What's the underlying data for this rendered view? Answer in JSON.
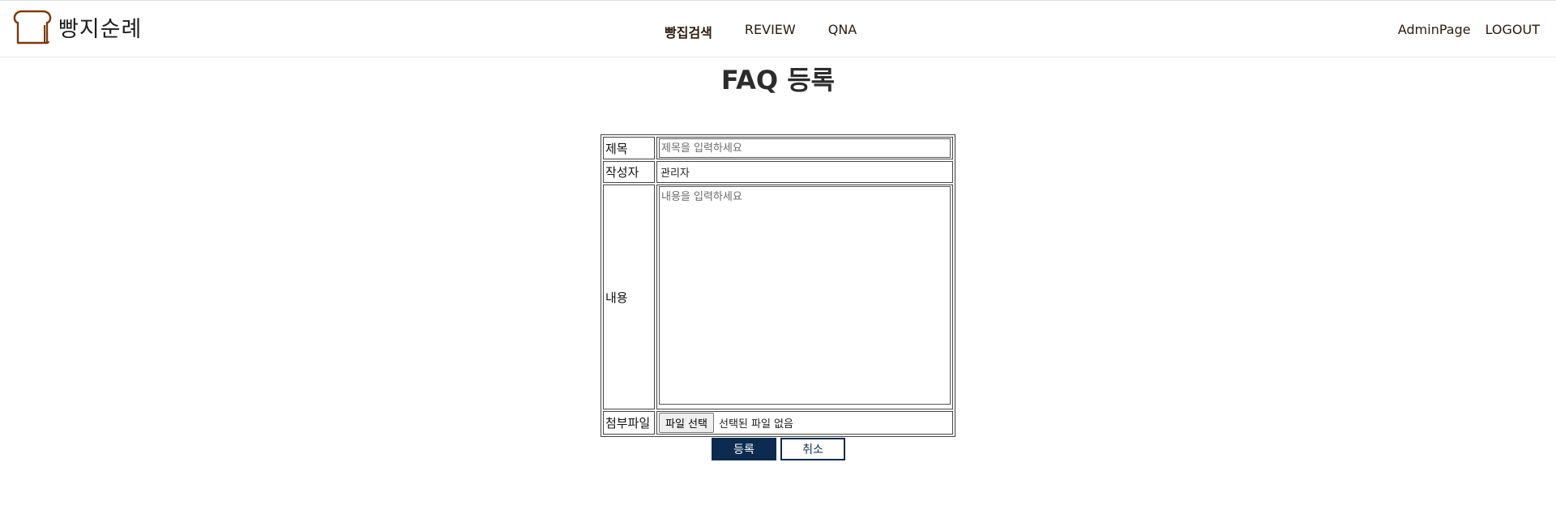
{
  "header": {
    "logo_text": "빵지순례",
    "nav": [
      {
        "label": "빵집검색"
      },
      {
        "label": "REVIEW"
      },
      {
        "label": "QNA"
      }
    ],
    "user_nav": [
      {
        "label": "AdminPage"
      },
      {
        "label": "LOGOUT"
      }
    ]
  },
  "page": {
    "title": "FAQ 등록"
  },
  "form": {
    "title_label": "제목",
    "title_placeholder": "제목을 입력하세요",
    "writer_label": "작성자",
    "writer_value": "관리자",
    "content_label": "내용",
    "content_placeholder": "내용을 입력하세요",
    "file_label": "첨부파일",
    "file_button": "파일 선택",
    "file_status": "선택된 파일 없음"
  },
  "buttons": {
    "submit": "등록",
    "cancel": "취소"
  },
  "colors": {
    "primary": "#0b2b4f",
    "logo_brown": "#7a3a0c"
  }
}
